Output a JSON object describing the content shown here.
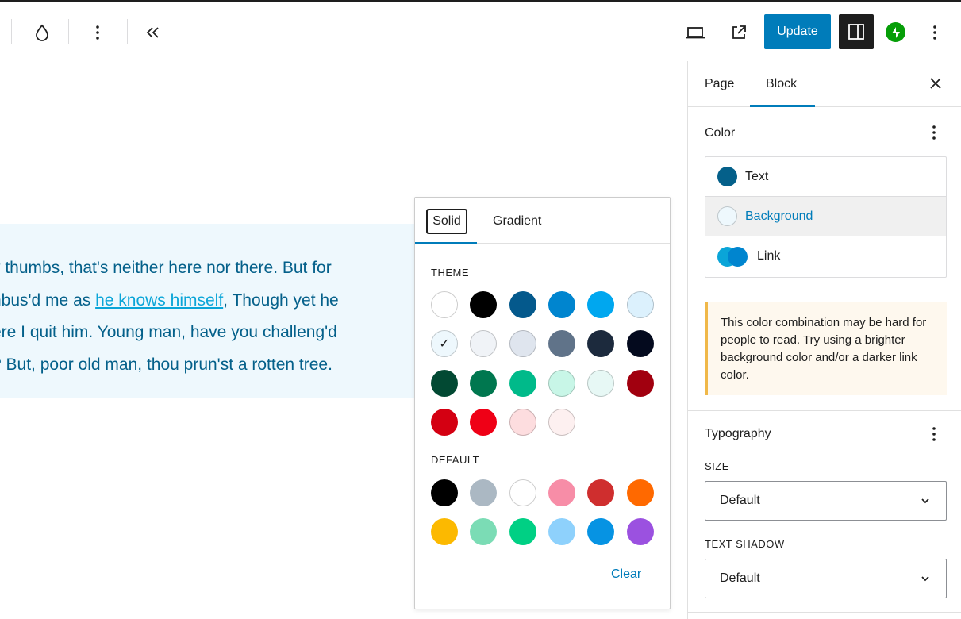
{
  "toolbar": {
    "update_label": "Update",
    "icons": [
      "droplet-icon",
      "more-vertical-icon",
      "collapse-left-icon",
      "desktop-preview-icon",
      "external-link-icon",
      "sidebar-toggle-icon",
      "jetpack-icon",
      "options-icon"
    ]
  },
  "canvas": {
    "lines": [
      {
        "before": "y thumbs, that's neither here nor there. But for",
        "link": "",
        "after": ""
      },
      {
        "before": "nbus'd me as ",
        "link": "he knows himself",
        "after": ", Though yet he"
      },
      {
        "before": "ere I quit him. Young man, have you challeng'd",
        "link": "",
        "after": ""
      },
      {
        "before": "? But, poor old man, thou prun'st a rotten tree.",
        "link": "",
        "after": ""
      }
    ],
    "block_background": "#eef8fd",
    "text_color": "#04608a",
    "link_color": "#0aa5d8"
  },
  "popover": {
    "tab_solid": "Solid",
    "tab_gradient": "Gradient",
    "theme_label": "THEME",
    "default_label": "DEFAULT",
    "clear_label": "Clear",
    "check_mark": "✓",
    "theme_colors": [
      "#ffffff",
      "#000000",
      "#04598c",
      "#0085cf",
      "#00a7ef",
      "#dcf1fd",
      "#eef8fd",
      "#f0f3f7",
      "#dfe5ee",
      "#607389",
      "#1c2a3d",
      "#040a1e",
      "#024933",
      "#00774f",
      "#00ba8a",
      "#c8f6e7",
      "#e7f8f5",
      "#a1000f",
      "#d40012",
      "#ef0016",
      "#fddddf",
      "#fdf0f0"
    ],
    "selected_theme_index": 6,
    "default_colors": [
      "#000000",
      "#abb8c3",
      "#ffffff",
      "#f78da7",
      "#cf2e2e",
      "#ff6900",
      "#fcb900",
      "#7bdcb5",
      "#00d084",
      "#8ed1fc",
      "#0693e3",
      "#9b51e0"
    ]
  },
  "sidebar": {
    "tab_page": "Page",
    "tab_block": "Block",
    "color_title": "Color",
    "color_items": [
      {
        "label": "Text",
        "swatch": "#04608a"
      },
      {
        "label": "Background",
        "swatch": "#eef8fd"
      },
      {
        "label": "Link",
        "swatch": "#0aa5d8"
      }
    ],
    "notice": "This color combination may be hard for people to read. Try using a brighter background color and/or a darker link color.",
    "typography_title": "Typography",
    "size_label": "SIZE",
    "size_value": "Default",
    "text_shadow_label": "TEXT SHADOW",
    "text_shadow_value": "Default"
  },
  "colors": {
    "accent": "#007cba",
    "notice_border": "#f0b849",
    "jetpack_green": "#069e08"
  }
}
